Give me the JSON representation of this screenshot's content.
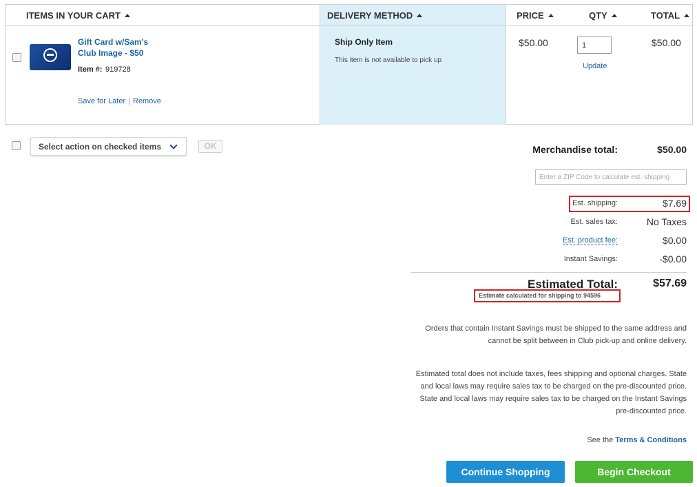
{
  "table": {
    "headers": {
      "items": "ITEMS IN YOUR CART",
      "delivery": "DELIVERY METHOD",
      "price": "PRICE",
      "qty": "QTY",
      "total": "TOTAL"
    }
  },
  "item": {
    "name": "Gift Card w/Sam's Club Image - $50",
    "item_number_label": "Item #:",
    "item_number": "919728",
    "save_for_later": "Save for Later",
    "remove": "Remove",
    "delivery_title": "Ship Only Item",
    "delivery_note": "This item is not available to pick up",
    "price": "$50.00",
    "quantity": "1",
    "update": "Update",
    "total": "$50.00"
  },
  "actions": {
    "select_label": "Select action on checked items",
    "ok_label": "OK"
  },
  "summary": {
    "merchandise_label": "Merchandise total:",
    "merchandise_value": "$50.00",
    "zip_placeholder": "Enter a ZIP Code to calculate est. shipping",
    "shipping_label": "Est. shipping:",
    "shipping_value": "$7.69",
    "tax_label": "Est. sales tax:",
    "tax_value": "No Taxes",
    "fee_label": "Est. product fee:",
    "fee_value": "$0.00",
    "savings_label": "Instant Savings:",
    "savings_value": "-$0.00",
    "estimated_label": "Estimated Total:",
    "estimated_value": "$57.69",
    "estimate_note": "Estimate calculated for shipping to 94596"
  },
  "notices": {
    "instant_savings_1": "Orders that contain Instant Savings must be shipped to the same address and",
    "instant_savings_2": "cannot be split between in Club pick-up and online delivery.",
    "estimated_1": "Estimated total does not include taxes, fees shipping and optional charges. State",
    "estimated_2": "and local laws may require sales tax to be charged on the pre-discounted price.",
    "estimated_3": "State and local laws may require sales tax to be charged on the Instant Savings",
    "estimated_4": "pre-discounted price.",
    "terms_prefix": "See the",
    "terms_link": "Terms & Conditions"
  },
  "buttons": {
    "continue_shopping": "Continue Shopping",
    "begin_checkout": "Begin Checkout"
  },
  "colors": {
    "link_blue": "#1a64a8",
    "delivery_bg": "#dcf0fa",
    "highlight_red": "#d2232a",
    "continue_blue": "#1d8fd4",
    "checkout_green": "#4db632"
  }
}
